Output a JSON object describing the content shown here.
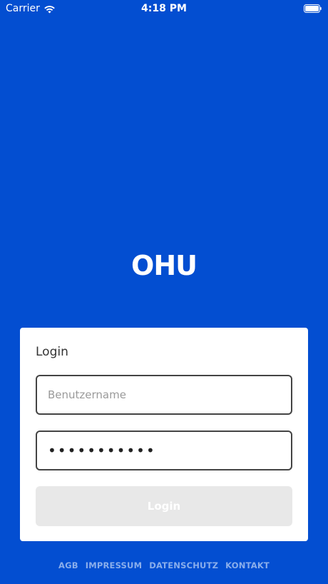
{
  "status_bar": {
    "carrier": "Carrier",
    "time": "4:18 PM",
    "wifi_icon": "wifi-icon",
    "battery_icon": "battery-full-icon"
  },
  "logo": {
    "text": "OHU"
  },
  "login_card": {
    "title": "Login",
    "username_placeholder": "Benutzername",
    "username_value": "",
    "password_value": "•••••••••••",
    "button_label": "Login"
  },
  "footer": {
    "links": [
      "AGB",
      "IMPRESSUM",
      "DATENSCHUTZ",
      "KONTAKT"
    ]
  },
  "colors": {
    "background": "#034ED1",
    "card": "#FFFFFF",
    "button_disabled": "#E8E8E8",
    "footer_link": "#8AAEEB"
  }
}
